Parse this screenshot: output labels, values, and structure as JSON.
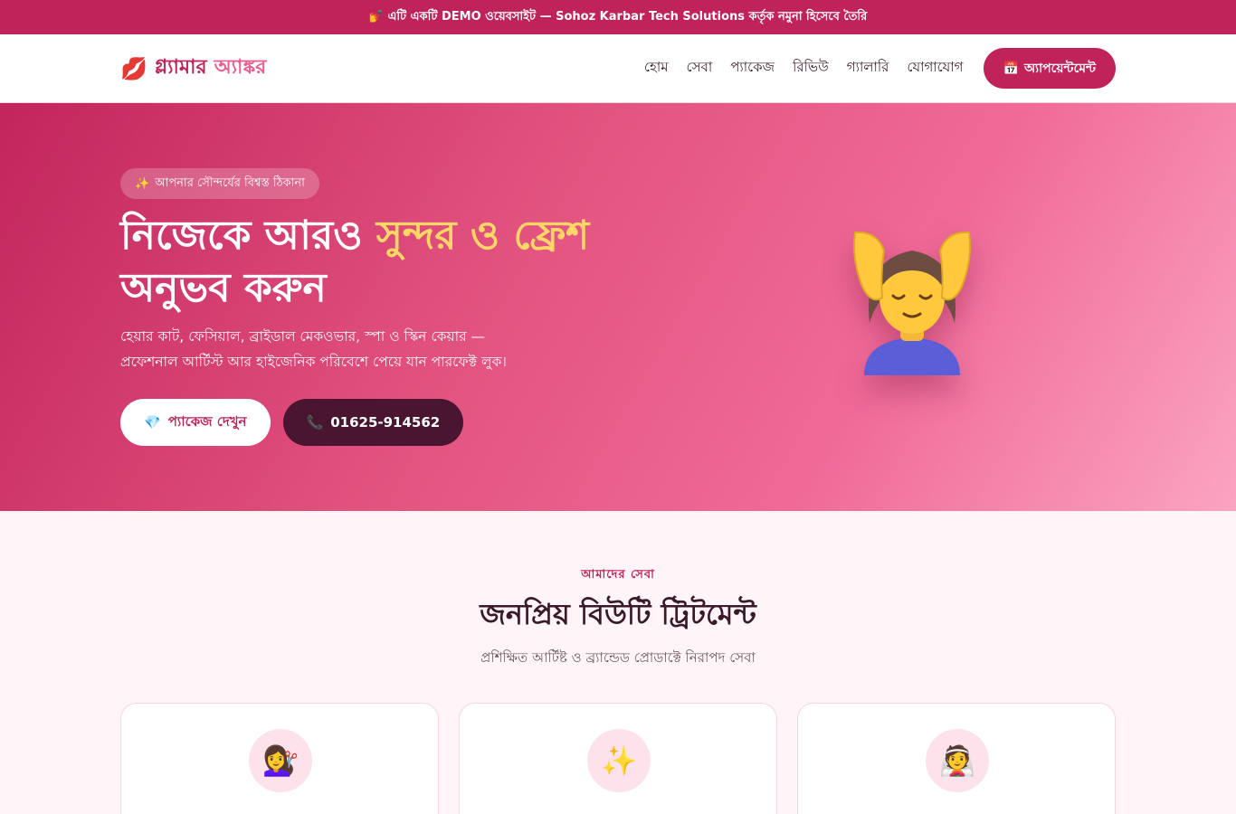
{
  "topbar": {
    "text": "💅 এটি একটি DEMO ওয়েবসাইট — Sohoz Karbar Tech Solutions কর্তৃক নমুনা হিসেবে তৈরি"
  },
  "nav": {
    "logo_icon": "💋",
    "logo_part1": "গ্ল্যামার",
    "logo_part2": "অ্যাঙ্কর",
    "links": [
      "হোম",
      "সেবা",
      "প্যাকেজ",
      "রিভিউ",
      "গ্যালারি",
      "যোগাযোগ"
    ],
    "cta_icon": "📅",
    "cta_label": "অ্যাপয়েন্টমেন্ট"
  },
  "hero": {
    "pill_icon": "✨",
    "pill_text": "আপনার সৌন্দর্যের বিশ্বস্ত ঠিকানা",
    "title_part1": "নিজেকে আরও ",
    "title_highlight": "সুন্দর ও ফ্রেশ",
    "title_part2": " অনুভব করুন",
    "desc_line1": "হেয়ার কাট, ফেসিয়াল, ব্রাইডাল মেকওভার, স্পা ও স্কিন কেয়ার —",
    "desc_line2": "প্রফেশনাল আর্টিস্ট আর হাইজেনিক পরিবেশে পেয়ে যান পারফেক্ট লুক।",
    "btn_primary_icon": "💎",
    "btn_primary_label": "প্যাকেজ দেখুন",
    "btn_phone_icon": "📞",
    "btn_phone_label": "01625-914562",
    "art_icon": "massage-woman-icon"
  },
  "services": {
    "label": "আমাদের সেবা",
    "title": "জনপ্রিয় বিউটি ট্রিটমেন্ট",
    "subtitle": "প্রশিক্ষিত আর্টিষ্ট ও ব্র্যান্ডেড প্রোডাক্টে নিরাপদ সেবা",
    "cards": [
      {
        "icon": "💇‍♀️"
      },
      {
        "icon": "✨"
      },
      {
        "icon": "👰"
      }
    ]
  },
  "colors": {
    "brand": "#c0235a",
    "accent": "#ffd766",
    "dark": "#4a1530"
  }
}
